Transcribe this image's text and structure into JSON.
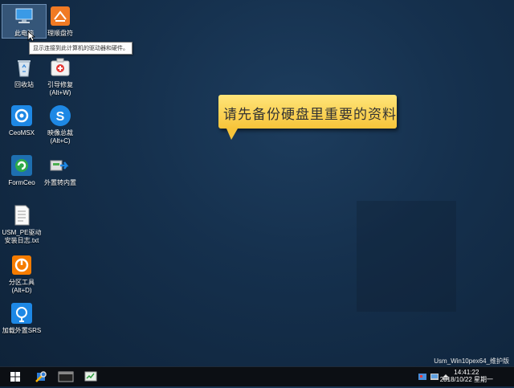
{
  "desktop": {
    "icons": [
      {
        "label": "此电脑",
        "icon": "this-pc-icon"
      },
      {
        "label": "理顺盘符",
        "icon": "drive-letter-icon"
      },
      {
        "label": "回收站",
        "icon": "recycle-bin-icon"
      },
      {
        "label": "引导修复\n(Alt+W)",
        "icon": "boot-repair-icon"
      },
      {
        "label": "CeoMSX",
        "icon": "ceomsx-icon"
      },
      {
        "label": "映像总裁\n(Alt+C)",
        "icon": "image-president-icon"
      },
      {
        "label": "FormCeo",
        "icon": "formceo-icon"
      },
      {
        "label": "外置转内置",
        "icon": "external-to-internal-icon"
      },
      {
        "label": "USM_PE驱动\n安装日志.txt",
        "icon": "text-file-icon"
      },
      {
        "label": "分区工具\n(Alt+D)",
        "icon": "partition-tool-icon"
      },
      {
        "label": "加载外置SRS",
        "icon": "load-srs-icon"
      }
    ],
    "tooltip": "显示连接到此计算机的驱动器和硬件。",
    "callout": "请先备份硬盘里重要的资料",
    "watermark": "Usm_Win10pex64_维护版"
  },
  "taskbar": {
    "items": [
      "start-icon",
      "tool-icon",
      "terminal-icon",
      "task-manager-icon"
    ],
    "time": "14:41:22",
    "date": "2018/10/22 星期一"
  },
  "colors": {
    "desktop_bg": "#15304d",
    "callout_bg": "#f7c43a",
    "taskbar_bg": "#0c0f14"
  }
}
